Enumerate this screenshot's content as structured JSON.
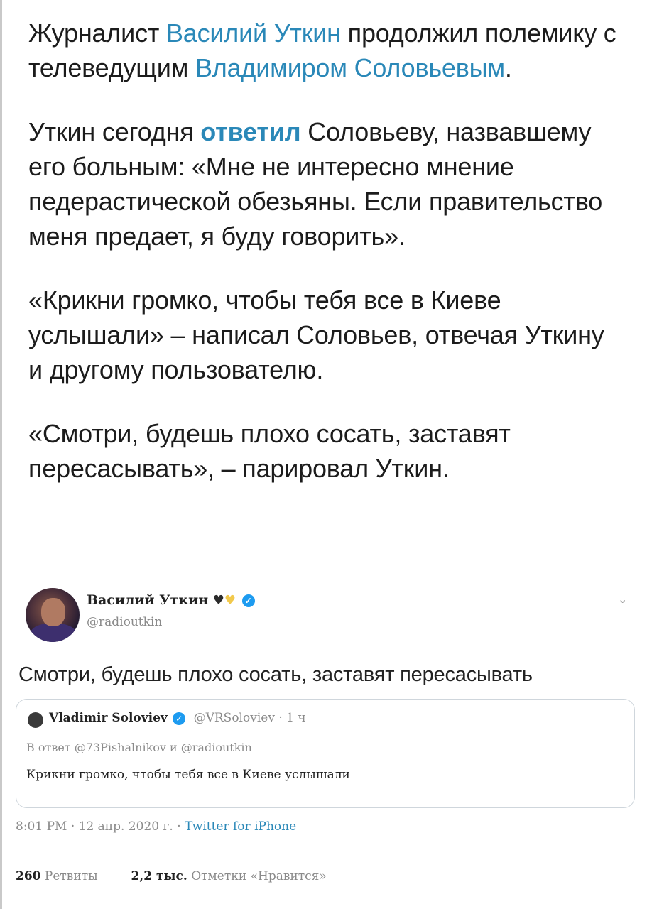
{
  "post": {
    "p1": {
      "t1": "Журналист ",
      "link1": "Василий Уткин",
      "t2": " продолжил полемику с телеведущим ",
      "link2": "Владимиром Соловьевым",
      "t3": "."
    },
    "p2": {
      "t1": "Уткин сегодня ",
      "link": "ответил",
      "t2": " Соловьеву, назвавшему его больным: «Мне не интересно мнение педерастической обезьяны. Если правительство меня предает, я буду говорить»."
    },
    "p3": "«Крикни громко, чтобы тебя все в Киеве услышали» – написал Соловьев, отвечая Уткину и другому пользователю.",
    "p4": "«Смотри, будешь плохо сосать, заставят пересасывать», – парировал Уткин."
  },
  "tweet": {
    "author_name": "Василий Уткин",
    "author_handle": "@radioutkin",
    "text": "Смотри, будешь плохо сосать, заставят пересасывать",
    "quote": {
      "name": "Vladimir Soloviev",
      "meta": "@VRSoloviev · 1 ч",
      "reply_to": "В ответ @73Pishalnikov и @radioutkin",
      "text": "Крикни громко, чтобы тебя все в Киеве услышали"
    },
    "timestamp": "8:01 PM · 12 апр. 2020 г. · ",
    "source": "Twitter for iPhone",
    "retweets_count": "260",
    "retweets_label": "Ретвиты",
    "likes_count": "2,2 тыс.",
    "likes_label": "Отметки «Нравится»"
  },
  "colors": {
    "link": "#2a88b8",
    "verified": "#1d9bf0",
    "muted": "#8a8a8a"
  },
  "icons": [
    "black-heart-icon",
    "yellow-heart-icon",
    "verified-icon",
    "chevron-down-icon"
  ]
}
